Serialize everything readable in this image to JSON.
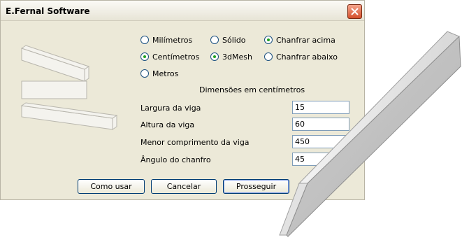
{
  "window": {
    "title": "E.Fernal Software",
    "close_icon": "close-icon"
  },
  "units": [
    {
      "label": "Milímetros",
      "checked": false
    },
    {
      "label": "Centímetros",
      "checked": true
    },
    {
      "label": "Metros",
      "checked": false
    }
  ],
  "render": [
    {
      "label": "Sólido",
      "checked": false
    },
    {
      "label": "3dMesh",
      "checked": true
    }
  ],
  "chamfer": [
    {
      "label": "Chanfrar acima",
      "checked": true
    },
    {
      "label": "Chanfrar abaixo",
      "checked": false
    }
  ],
  "dimensions_title": "Dimensões em centímetros",
  "fields": [
    {
      "label": "Largura da viga",
      "value": "15"
    },
    {
      "label": "Altura da viga",
      "value": "60"
    },
    {
      "label": "Menor comprimento da viga",
      "value": "450"
    },
    {
      "label": "Ângulo do chanfro",
      "value": "45"
    }
  ],
  "buttons": {
    "help": "Como usar",
    "cancel": "Cancelar",
    "proceed": "Prosseguir"
  },
  "colors": {
    "title_close": "#e0582d",
    "radio_check": "#21a121",
    "beam": "#c8c8c8"
  }
}
